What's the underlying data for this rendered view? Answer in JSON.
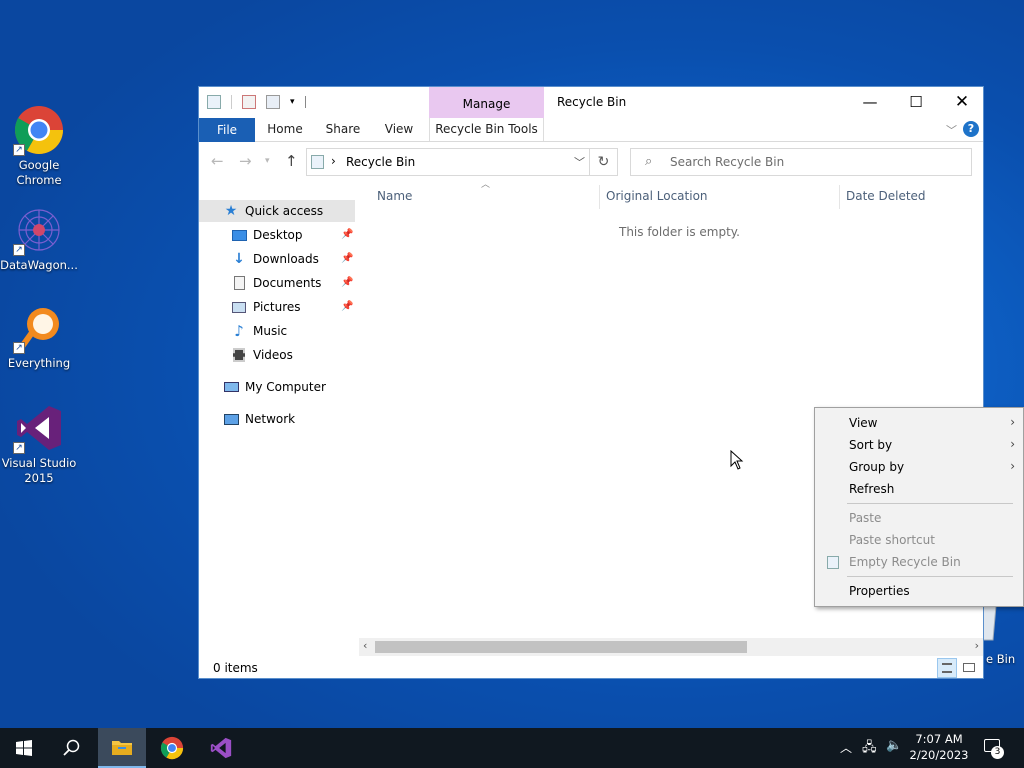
{
  "desktop": {
    "icons": [
      {
        "label": "Google\nChrome",
        "icon": "chrome-icon"
      },
      {
        "label": "DataWagon...",
        "icon": "datawagon-icon"
      },
      {
        "label": "Everything",
        "icon": "everything-icon"
      },
      {
        "label": "Visual Studio\n2015",
        "icon": "visual-studio-icon"
      }
    ],
    "partial_recycle_label": "e Bin"
  },
  "window": {
    "title": "Recycle Bin",
    "contextual_tab_group": "Manage",
    "ribbon_tabs": [
      "File",
      "Home",
      "Share",
      "View",
      "Recycle Bin Tools"
    ],
    "address": "Recycle Bin",
    "search_placeholder": "Search Recycle Bin",
    "nav": {
      "quick_access": "Quick access",
      "items": [
        "Desktop",
        "Downloads",
        "Documents",
        "Pictures",
        "Music",
        "Videos"
      ],
      "my_computer": "My Computer",
      "network": "Network"
    },
    "columns": [
      "Name",
      "Original Location",
      "Date Deleted"
    ],
    "empty_text": "This folder is empty.",
    "status": "0 items"
  },
  "context_menu": {
    "view": "View",
    "sort_by": "Sort by",
    "group_by": "Group by",
    "refresh": "Refresh",
    "paste": "Paste",
    "paste_shortcut": "Paste shortcut",
    "empty_recycle_bin": "Empty Recycle Bin",
    "properties": "Properties"
  },
  "taskbar": {
    "time": "7:07 AM",
    "date": "2/20/2023",
    "notification_count": "3"
  },
  "colors": {
    "accent": "#1a5fb4",
    "contextual_tab": "#e9c8f0",
    "taskbar": "#101820"
  }
}
